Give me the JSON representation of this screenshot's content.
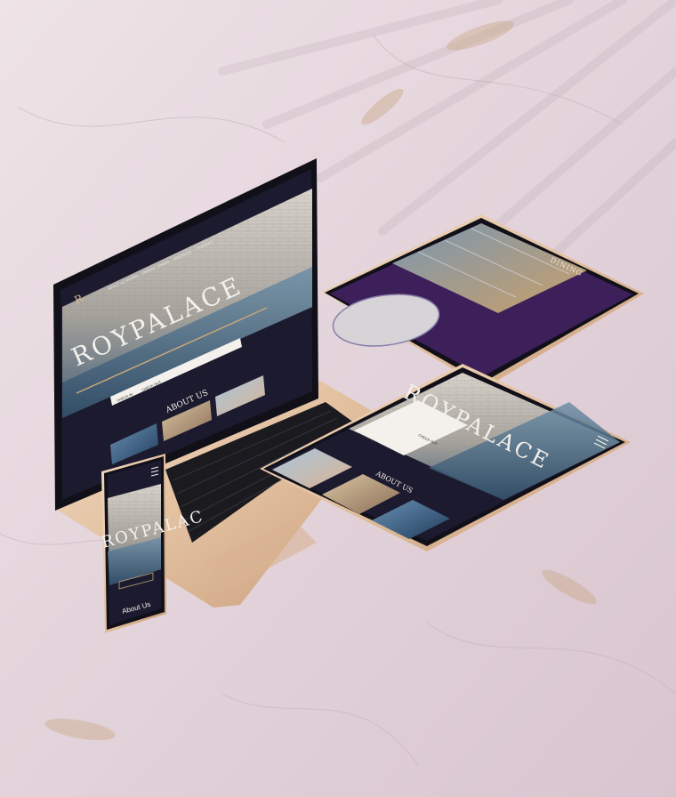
{
  "brand": {
    "wordmark": "ROYPALACE",
    "monogram": "R"
  },
  "laptop": {
    "nav_items": [
      "ABOUT US",
      "ROOMS",
      "OFFERS",
      "DINING",
      "MEETINGS",
      "CONTACT"
    ],
    "checkin_label": "CHECK IN",
    "checkout_label": "CHECK OUT",
    "section_title": "ABOUT US"
  },
  "tablet_back": {
    "section_title": "DINING"
  },
  "tablet_front": {
    "wordmark": "ROYPALACE",
    "checkin_label": "CHECK IN",
    "checkout_label": "CHECK OUT",
    "section_title": "ABOUT US"
  },
  "phone": {
    "wordmark": "ROYPALAC",
    "section_title": "About Us"
  },
  "colors": {
    "background": "#e6d8de",
    "device_gold": "#e4c3a4",
    "screen_navy": "#1c1a2e",
    "dining_purple": "#3d1f5a",
    "water": "#5d7f9a",
    "stone": "#c9c4bb"
  }
}
